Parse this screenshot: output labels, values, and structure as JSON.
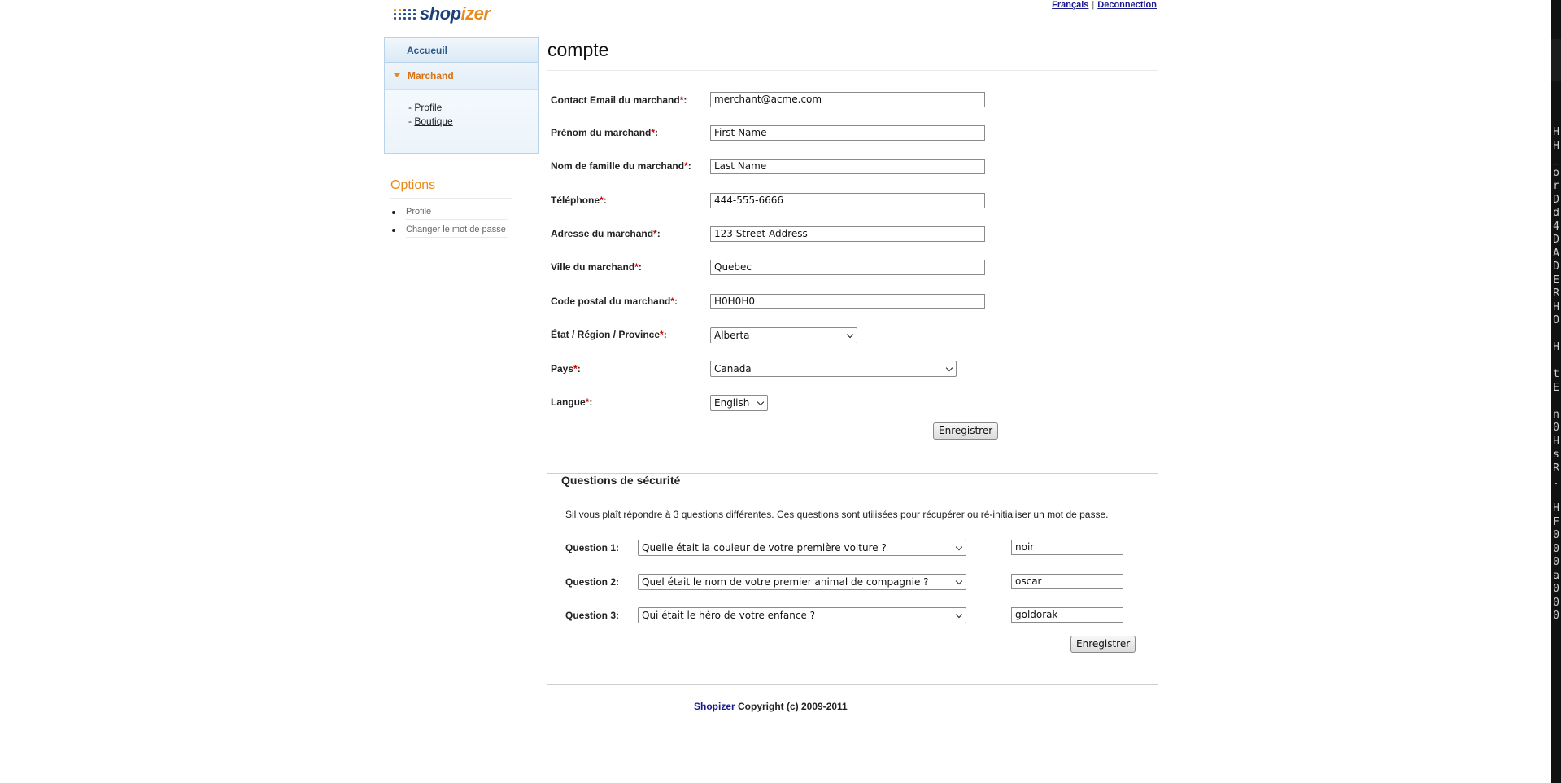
{
  "header": {
    "logo": {
      "text_a": "shop",
      "text_b": "izer"
    },
    "links": {
      "language": "Français",
      "separator": "|",
      "logout": "Deconnection"
    }
  },
  "sidebar": {
    "home": "Accueuil",
    "merchant": "Marchand",
    "sub_prefix": "- ",
    "sub_items": [
      "Profile",
      "Boutique"
    ]
  },
  "options": {
    "title": "Options",
    "items": [
      "Profile",
      "Changer le mot de passe"
    ]
  },
  "main": {
    "title": "compte",
    "required_mark": "*",
    "colon": ":",
    "fields": [
      {
        "label": "Contact Email du marchand",
        "value": "merchant@acme.com"
      },
      {
        "label": "Prénom du marchand",
        "value": "First Name"
      },
      {
        "label": "Nom de famille du marchand",
        "value": "Last Name"
      },
      {
        "label": "Téléphone",
        "value": "444-555-6666"
      },
      {
        "label": "Adresse du marchand",
        "value": "123 Street Address"
      },
      {
        "label": "Ville du marchand",
        "value": "Quebec"
      },
      {
        "label": "Code postal du marchand",
        "value": "H0H0H0"
      }
    ],
    "state": {
      "label": "État / Région / Province",
      "value": "Alberta"
    },
    "country": {
      "label": "Pays",
      "value": "Canada"
    },
    "language": {
      "label": "Langue",
      "value": "English"
    },
    "save_label": "Enregistrer"
  },
  "security": {
    "legend": "Questions de sécurité",
    "info": "Sil vous plaît répondre à 3 questions différentes. Ces questions sont utilisées pour récupérer ou ré-initialiser un mot de passe.",
    "questions": [
      {
        "label": "Question 1:",
        "question": "Quelle était la couleur de votre première voiture ?",
        "answer": "noir"
      },
      {
        "label": "Question 2:",
        "question": "Quel était le nom de votre premier animal de compagnie ?",
        "answer": "oscar"
      },
      {
        "label": "Question 3:",
        "question": "Qui était le héro de votre enfance ?",
        "answer": "goldorak"
      }
    ],
    "save_label": "Enregistrer"
  },
  "footer": {
    "link": "Shopizer",
    "text": " Copyright (c) 2009-2011"
  },
  "terminal_chars": [
    "H",
    "H",
    "_",
    "o",
    "r",
    "D",
    "d",
    "4",
    "D",
    "A",
    "D",
    "E",
    "R",
    "H",
    "O",
    " ",
    "H",
    " ",
    "t",
    "E",
    " ",
    "n",
    "0",
    "H",
    "s",
    "R",
    ".",
    " ",
    "H",
    "F",
    "0",
    "0",
    "0",
    "a",
    "0",
    "0",
    "0"
  ],
  "colors": {
    "accent_orange": "#e88a1a",
    "brand_blue": "#1d3f7a",
    "required_red": "#cc0000",
    "link_blue": "#1a1a8a"
  }
}
